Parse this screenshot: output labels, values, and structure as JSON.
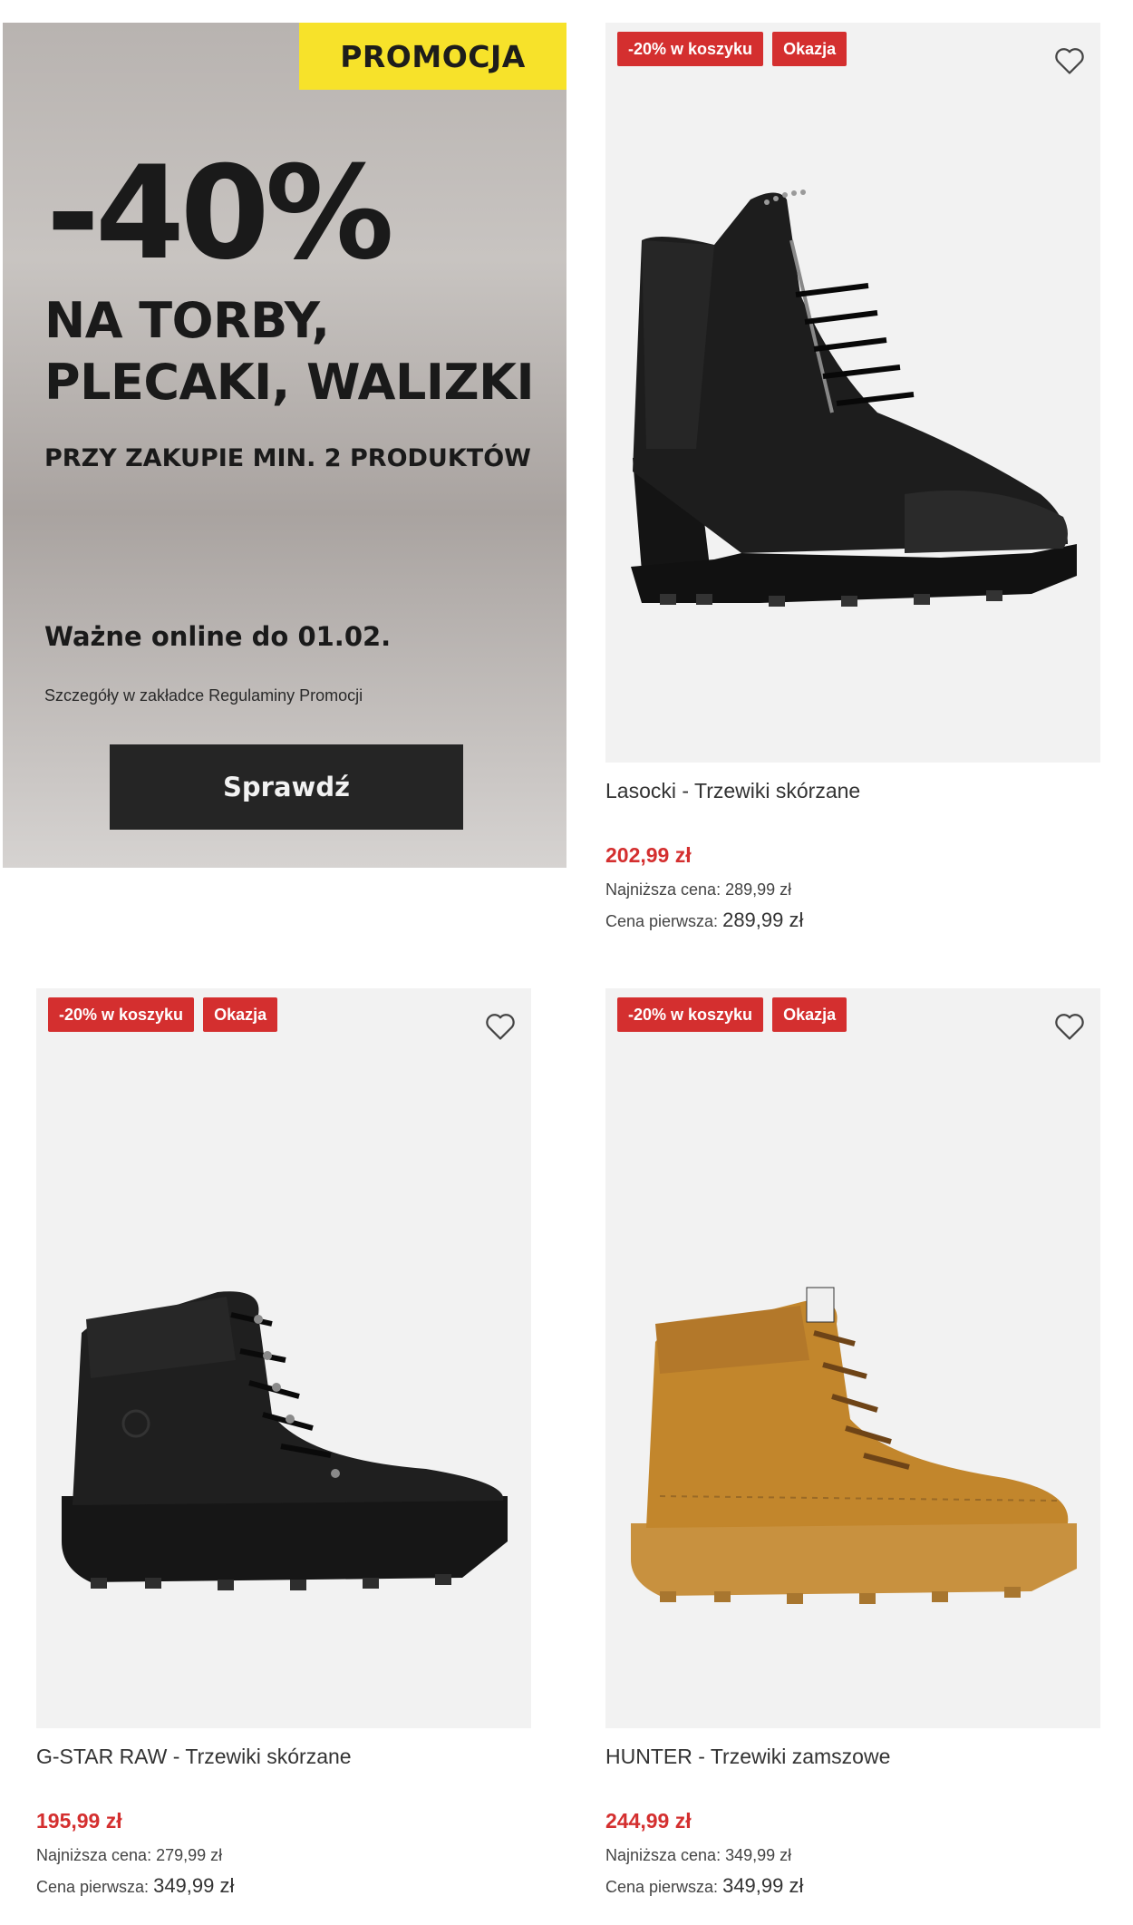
{
  "promo": {
    "tag": "PROMOCJA",
    "discount": "-40%",
    "headline_line1": "NA TORBY,",
    "headline_line2": "PLECAKI, WALIZKI",
    "subline": "PRZY ZAKUPIE MIN. 2 PRODUKTÓW",
    "valid": "Ważne online do 01.02.",
    "details": "Szczegóły w zakładce Regulaminy Promocji",
    "button": "Sprawdź",
    "colors": {
      "tag_bg": "#f7e22a",
      "button_bg": "#252525"
    }
  },
  "products": [
    {
      "badges": [
        "-20% w koszyku",
        "Okazja"
      ],
      "title": "Lasocki - Trzewiki skórzane",
      "price": "202,99 zł",
      "lowest_label": "Najniższa cena:",
      "lowest_value": "289,99 zł",
      "first_label": "Cena pierwsza:",
      "first_value": "289,99 zł",
      "image_icon": "black-heeled-boot-icon"
    },
    {
      "badges": [
        "-20% w koszyku",
        "Okazja"
      ],
      "title": "G-STAR RAW - Trzewiki skórzane",
      "price": "195,99 zł",
      "lowest_label": "Najniższa cena:",
      "lowest_value": "279,99 zł",
      "first_label": "Cena pierwsza:",
      "first_value": "349,99 zł",
      "image_icon": "black-work-boot-icon"
    },
    {
      "badges": [
        "-20% w koszyku",
        "Okazja"
      ],
      "title": "HUNTER - Trzewiki zamszowe",
      "price": "244,99 zł",
      "lowest_label": "Najniższa cena:",
      "lowest_value": "349,99 zł",
      "first_label": "Cena pierwsza:",
      "first_value": "349,99 zł",
      "image_icon": "tan-work-boot-icon"
    }
  ],
  "colors": {
    "badge": "#d42f2f",
    "price": "#d42f2f",
    "card_bg": "#f2f2f2"
  }
}
